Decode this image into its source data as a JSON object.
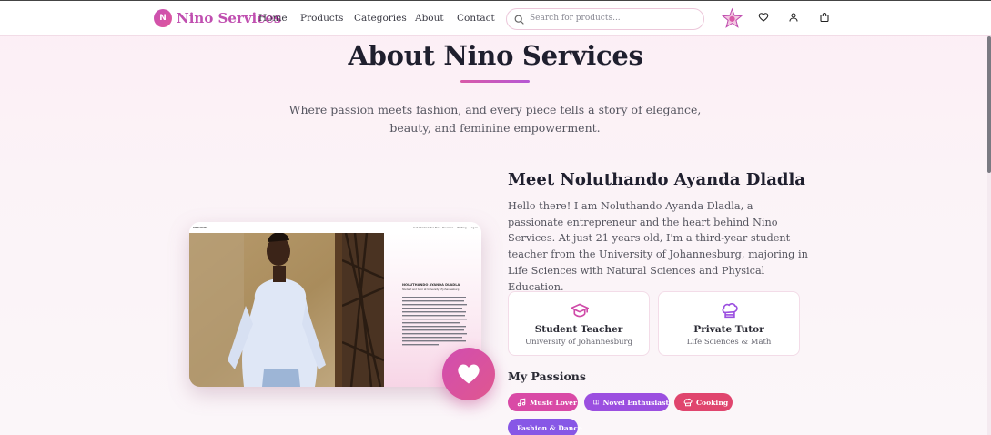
{
  "brand": {
    "logo_letter": "N",
    "name": "Nino Services"
  },
  "nav": [
    "Home",
    "Products",
    "Categories",
    "About",
    "Contact"
  ],
  "search": {
    "placeholder": "Search for products..."
  },
  "page": {
    "title": "About Nino Services",
    "subtitle": "Where passion meets fashion, and every piece tells a story of elegance, beauty, and feminine empowerment."
  },
  "profile": {
    "heading": "Meet Noluthando Ayanda Dladla",
    "bio": "Hello there! I am Noluthando Ayanda Dladla, a passionate entrepreneur and the heart behind Nino Services. At just 21 years old, I'm a third-year student teacher from the University of Johannesburg, majoring in Life Sciences with Natural Sciences and Physical Education.",
    "cards": [
      {
        "icon": "graduation-cap-icon",
        "label": "Student Teacher",
        "sub": "University of Johannesburg"
      },
      {
        "icon": "chef-hat-icon",
        "label": "Private Tutor",
        "sub": "Life Sciences & Math"
      }
    ]
  },
  "passions": {
    "title": "My Passions",
    "items": [
      {
        "label": "Music Lover",
        "icon": "music-icon",
        "color": "#d94aa6"
      },
      {
        "label": "Novel Enthusiast",
        "icon": "book-icon",
        "color": "#9b4fe0"
      },
      {
        "label": "Cooking",
        "icon": "chef-hat-icon",
        "color": "#e0456e"
      },
      {
        "label": "Fashion & Dance",
        "icon": "",
        "color": "#8757e6"
      }
    ]
  },
  "mini_screenshot": {
    "nav_left": "SERVICES",
    "nav_items": [
      "Get Started For Free",
      "Reviews",
      "Writing",
      "Log in"
    ],
    "name": "NOLUTHANDO AYANDA DLADLA",
    "tagline": "Student and tutor at University of Johannesburg"
  },
  "colors": {
    "brand": "#c04fb0",
    "accent": "#d85aa8",
    "purple": "#b657d4"
  }
}
